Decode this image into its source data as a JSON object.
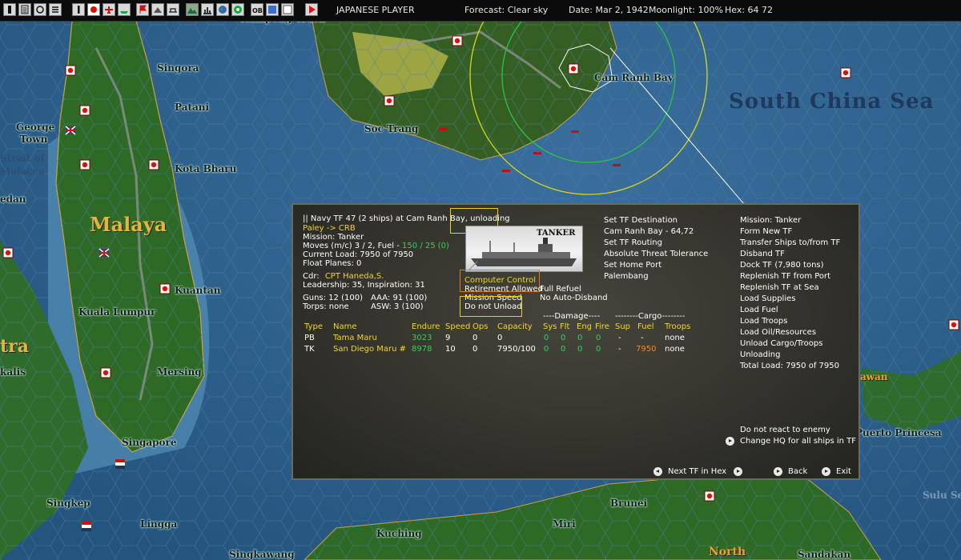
{
  "toolbar": {
    "player": "JAPANESE PLAYER",
    "forecast": "Forecast: Clear sky",
    "date": "Date: Mar 2, 1942",
    "moonlight": "Moonlight: 100%",
    "hex": "Hex: 64 72"
  },
  "map": {
    "labels": {
      "kampong_trach": "Kampong Trach",
      "singora": "Singora",
      "patani": "Patani",
      "george_town": "George Town",
      "strait_of_malacca": "Strait of Malacca",
      "kota_bharu": "Kota Bharu",
      "soc_trang": "Soc Trang",
      "cam_ranh_bay": "Cam Ranh Bay",
      "south_china_sea": "South China Sea",
      "malaya": "Malaya",
      "edan": "edan",
      "kuantan": "Kuantan",
      "kuala_lumpur": "Kuala Lumpur",
      "tra": "tra",
      "kalis": "kalis",
      "mersing": "Mersing",
      "singapore": "Singapore",
      "singkep": "Singkep",
      "lingga": "Lingga",
      "kuching": "Kuching",
      "singkawang": "Singkawang",
      "brunei": "Brunei",
      "miri": "Miri",
      "north": "North",
      "sandakan": "Sandakan",
      "puerto_princesa": "Puerto Princesa",
      "awan": "awan",
      "sulu_sea": "Sulu Se"
    }
  },
  "dialog": {
    "header": {
      "tf_title": "|| Navy TF 47 (2 ships) at Cam Ranh Bay, unloading",
      "route": "Paley -> CRB",
      "mission": "Mission: Tanker",
      "moves_prefix": "Moves (m/c) 3 / 2, Fuel - ",
      "moves_fuel": "150 / 25 (0)",
      "current_load": "Current Load: 7950 of 7950",
      "float_planes": "Float Planes: 0",
      "cdr_prefix": "Cdr:",
      "cdr_name": "CPT Haneda,S.",
      "leadership": "Leadership: 35, Inspiration: 31",
      "guns": "Guns: 12 (100)",
      "aaa": "AAA: 91 (100)",
      "torps": "Torps: none",
      "asw": "ASW: 3 (100)"
    },
    "ship_image_label": "TANKER",
    "options": {
      "computer_control": "Computer Control",
      "retirement": "Retirement Allowed",
      "full_refuel": "Full Refuel",
      "mission_speed": "Mission Speed",
      "no_auto_disband": "No Auto-Disband",
      "do_not_unload": "Do not Unload"
    },
    "mid_commands": [
      "Set TF Destination",
      "Cam Ranh Bay - 64,72",
      "Set TF Routing",
      "Absolute Threat Tolerance",
      "Set Home Port",
      "Palembang"
    ],
    "right_commands": [
      "Mission: Tanker",
      "Form New TF",
      "Transfer Ships to/from TF",
      "Disband TF",
      "Dock TF (7,980 tons)",
      "Replenish TF from Port",
      "Replenish TF at Sea",
      "Load Supplies",
      "Load Fuel",
      "Load Troops",
      "Load Oil/Resources",
      "Unload Cargo/Troops",
      "Unloading",
      "Total Load: 7950 of 7950"
    ],
    "bottom_right": {
      "no_react": "Do not react to enemy",
      "change_hq": "Change HQ for all ships in TF"
    },
    "table": {
      "group_damage": "----Damage----",
      "group_cargo": "--------Cargo--------",
      "headers": {
        "type": "Type",
        "name": "Name",
        "endure": "Endure",
        "speed": "Speed",
        "ops": "Ops",
        "capacity": "Capacity",
        "sys": "Sys",
        "flt": "Flt",
        "eng": "Eng",
        "fire": "Fire",
        "sup": "Sup",
        "fuel": "Fuel",
        "troops": "Troops"
      },
      "rows": [
        {
          "type": "PB",
          "name": "Tama Maru",
          "endure": "3023",
          "speed": "9",
          "ops": "0",
          "capacity": "0",
          "sys": "0",
          "flt": "0",
          "eng": "0",
          "fire": "0",
          "sup": "-",
          "fuel": "-",
          "troops": "none"
        },
        {
          "type": "TK",
          "name": "San Diego Maru #",
          "endure": "8978",
          "speed": "10",
          "ops": "0",
          "capacity": "7950/100",
          "sys": "0",
          "flt": "0",
          "eng": "0",
          "fire": "0",
          "sup": "-",
          "fuel": "7950",
          "troops": "none"
        }
      ]
    },
    "nav": {
      "next_tf": "Next TF in Hex",
      "back": "Back",
      "exit": "Exit"
    }
  }
}
